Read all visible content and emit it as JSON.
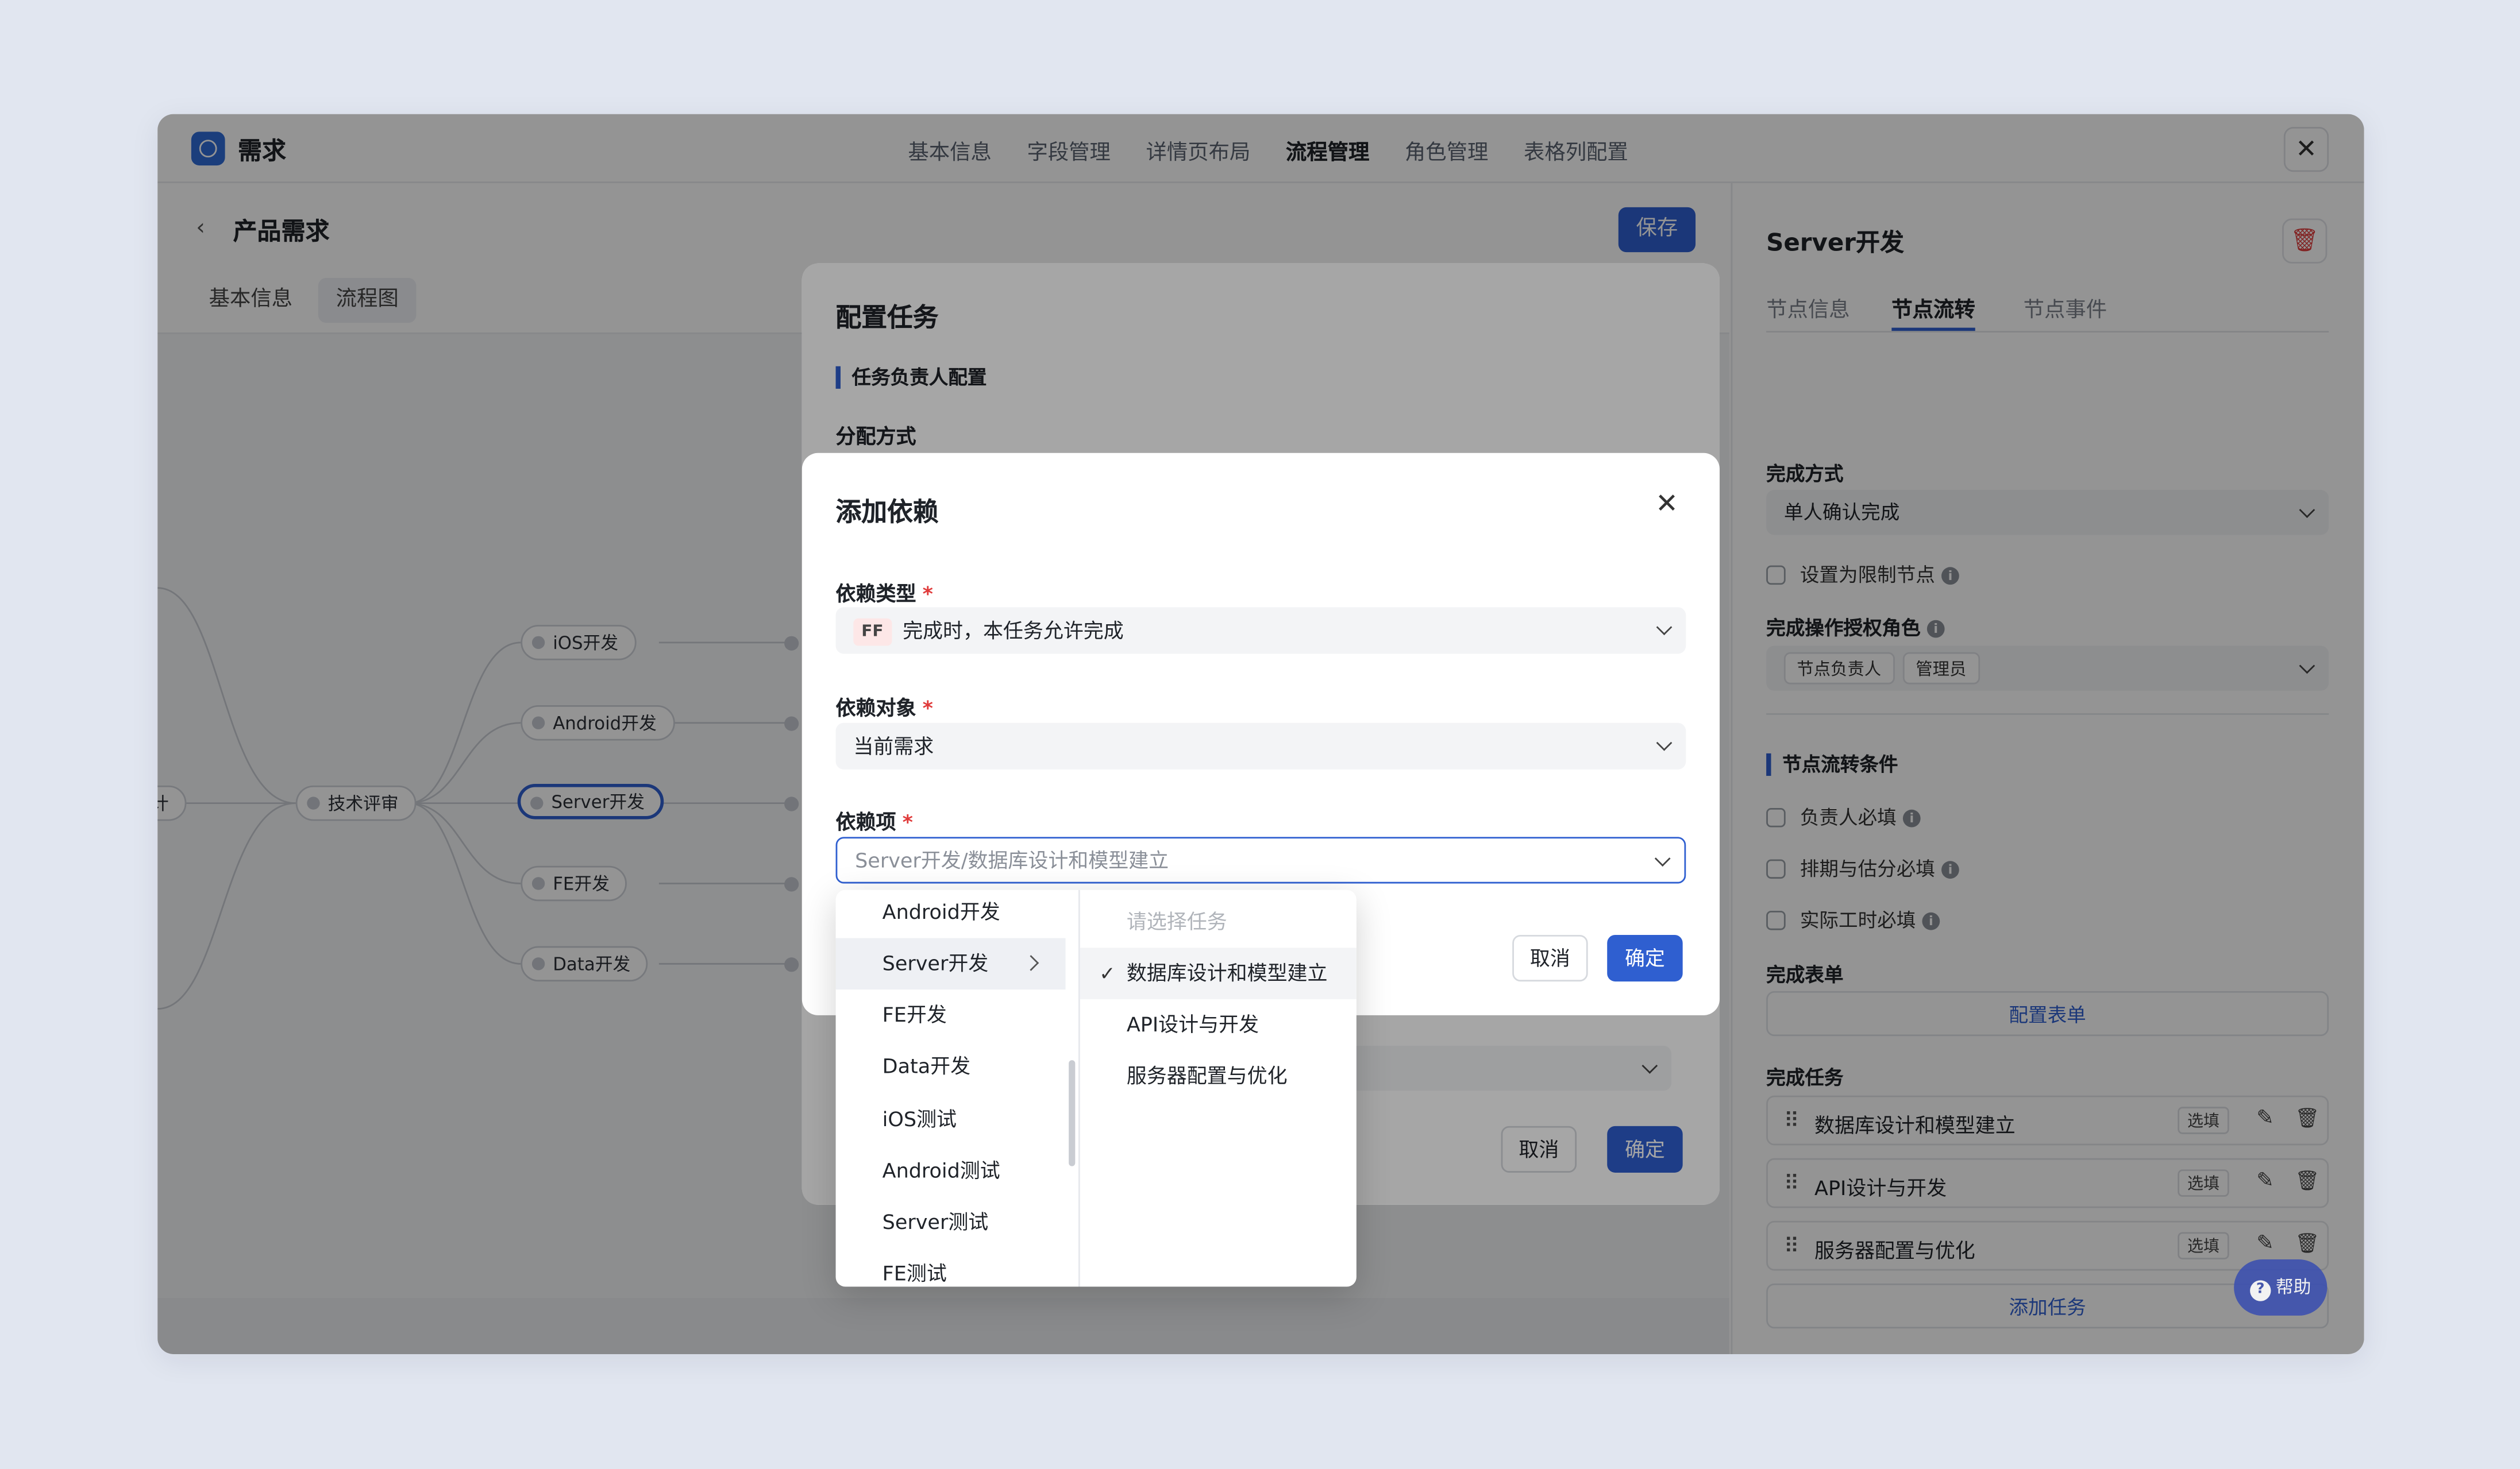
{
  "app": {
    "title": "需求"
  },
  "top_nav": [
    "基本信息",
    "字段管理",
    "详情页布局",
    "流程管理",
    "角色管理",
    "表格列配置"
  ],
  "page": {
    "title": "产品需求",
    "save": "保存",
    "tabs": [
      "基本信息",
      "流程图"
    ]
  },
  "flow_nodes": {
    "left_partial": "计",
    "tech_review": "技术评审",
    "ios": "iOS开发",
    "android": "Android开发",
    "server": "Server开发",
    "fe": "FE开发",
    "data": "Data开发"
  },
  "right_panel": {
    "title": "Server开发",
    "tabs": [
      "节点信息",
      "节点流转",
      "节点事件"
    ],
    "completion_label": "完成方式",
    "completion_value": "单人确认完成",
    "restrict_label": "设置为限制节点",
    "auth_label": "完成操作授权角色",
    "auth_tags": [
      "节点负责人",
      "管理员"
    ],
    "conditions_title": "节点流转条件",
    "conditions": [
      "负责人必填",
      "排期与估分必填",
      "实际工时必填"
    ],
    "form_label": "完成表单",
    "form_button": "配置表单",
    "tasks_label": "完成任务",
    "tasks": [
      "数据库设计和模型建立",
      "API设计与开发",
      "服务器配置与优化"
    ],
    "task_option": "选填",
    "add_task": "添加任务"
  },
  "config_modal": {
    "title": "配置任务",
    "section": "任务负责人配置",
    "assign_label": "分配方式",
    "cancel": "取消",
    "ok": "确定"
  },
  "dep_modal": {
    "title": "添加依赖",
    "type_label": "依赖类型",
    "type_badge": "FF",
    "type_value": "完成时，本任务允许完成",
    "target_label": "依赖对象",
    "target_value": "当前需求",
    "item_label": "依赖项",
    "item_placeholder": "Server开发/数据库设计和模型建立",
    "cancel": "取消",
    "ok": "确定"
  },
  "dropdown": {
    "col1": [
      "Android开发",
      "Server开发",
      "FE开发",
      "Data开发",
      "iOS测试",
      "Android测试",
      "Server测试",
      "FE测试"
    ],
    "col2_placeholder": "请选择任务",
    "col2": [
      "数据库设计和模型建立",
      "API设计与开发",
      "服务器配置与优化"
    ]
  },
  "help": {
    "label": "帮助"
  },
  "colors": {
    "primary": "#2f5fd0",
    "danger": "#e03b3b",
    "background": "#e1e6f0"
  }
}
